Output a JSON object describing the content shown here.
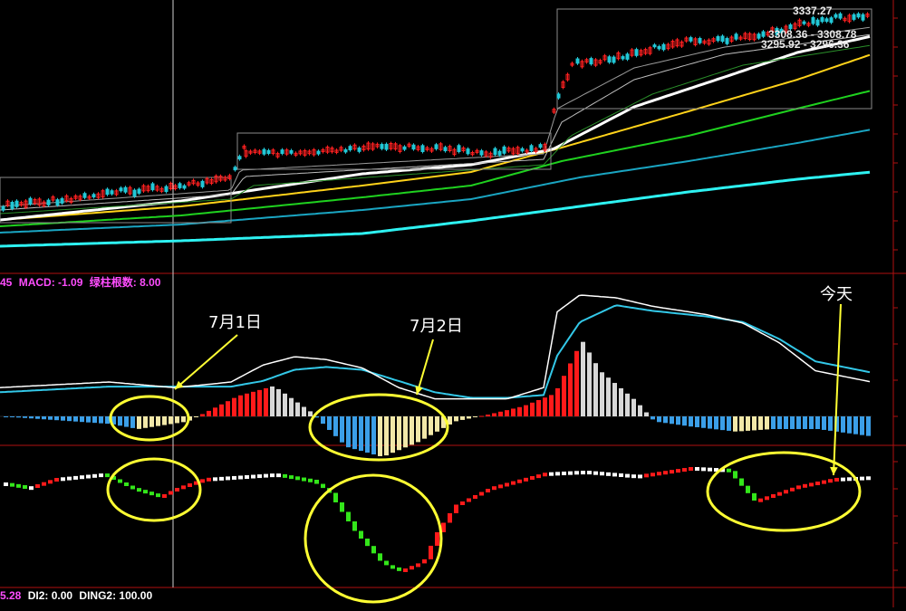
{
  "colors": {
    "background": "#000000",
    "up": "#ff2020",
    "down": "#22c7d6",
    "annotation": "#ffff33",
    "macd_pos": "#ff1a1a",
    "macd_pos_fading": "#d8d8d8",
    "macd_neg": "#3b9fe8",
    "macd_neg_fading": "#f2e8a8",
    "ind_up": "#ff1a1a",
    "ind_down": "#33e61a",
    "ind_flat": "#ffffff",
    "ma_white": "#ffffff",
    "ma_yellow": "#ffd21a",
    "ma_green": "#1fd11f",
    "ma_teal": "#1aa5c2",
    "ma_cyan": "#2ef2f2",
    "divider": "#b01010"
  },
  "macd_bar": {
    "prefix": "45",
    "macd_label": "MACD: -1.09",
    "green_count_label": "绿柱根数: 8.00"
  },
  "ind_bar": {
    "prefix": "5.28",
    "di2_label": "DI2: 0.00",
    "ding2_label": "DING2: 100.00"
  },
  "price_labels": {
    "high": "3337.27",
    "range1": "3308.36 - 3308.78",
    "range2": "3295.92 - 3296.36"
  },
  "annotations": {
    "july1": "7月1日",
    "july2": "7月2日",
    "today": "今天"
  },
  "chart_data": [
    {
      "type": "line",
      "title": "",
      "note": "main price panel with candlesticks and moving averages",
      "price_labels": [
        "3337.27",
        "3308.36 - 3308.78",
        "3295.92 - 3296.36"
      ],
      "segments": [
        {
          "name": "",
          "x": [
            0,
            255
          ],
          "open_close": [
            3295,
            3297
          ]
        },
        {
          "name": "",
          "x": [
            255,
            608
          ],
          "open_close": [
            3308,
            3308.5
          ]
        },
        {
          "name": "",
          "x": [
            608,
            962
          ],
          "open_close": [
            3325,
            3337
          ]
        }
      ]
    },
    {
      "type": "line",
      "title": "MACD",
      "legend": [
        "MACD: -1.09",
        "绿柱根数: 8.00"
      ],
      "x": [
        0,
        60,
        120,
        192,
        225,
        255,
        290,
        325,
        360,
        400,
        440,
        480,
        520,
        560,
        600,
        615,
        640,
        680,
        720,
        780,
        820,
        860,
        900,
        962
      ],
      "dif": [
        -2,
        -1,
        0,
        -2,
        -1,
        0,
        6,
        9,
        8,
        5,
        -2,
        -6,
        -6,
        -6,
        -2,
        25,
        31,
        30,
        27,
        24,
        21,
        14,
        4,
        0
      ],
      "dea": [
        -3,
        -2,
        -1,
        -1,
        -1,
        -1,
        1,
        5,
        6,
        5,
        1,
        -3,
        -5,
        -5,
        -4,
        10,
        22,
        28,
        26,
        24,
        22,
        16,
        8,
        4
      ],
      "histogram_note": "red/white above zero, blue/beige below zero"
    },
    {
      "type": "bar",
      "title": "",
      "legend": [
        "DI2: 0.00",
        "DING2: 100.00"
      ],
      "note": "trend indicator columns: red rising, green falling, white flat"
    }
  ]
}
